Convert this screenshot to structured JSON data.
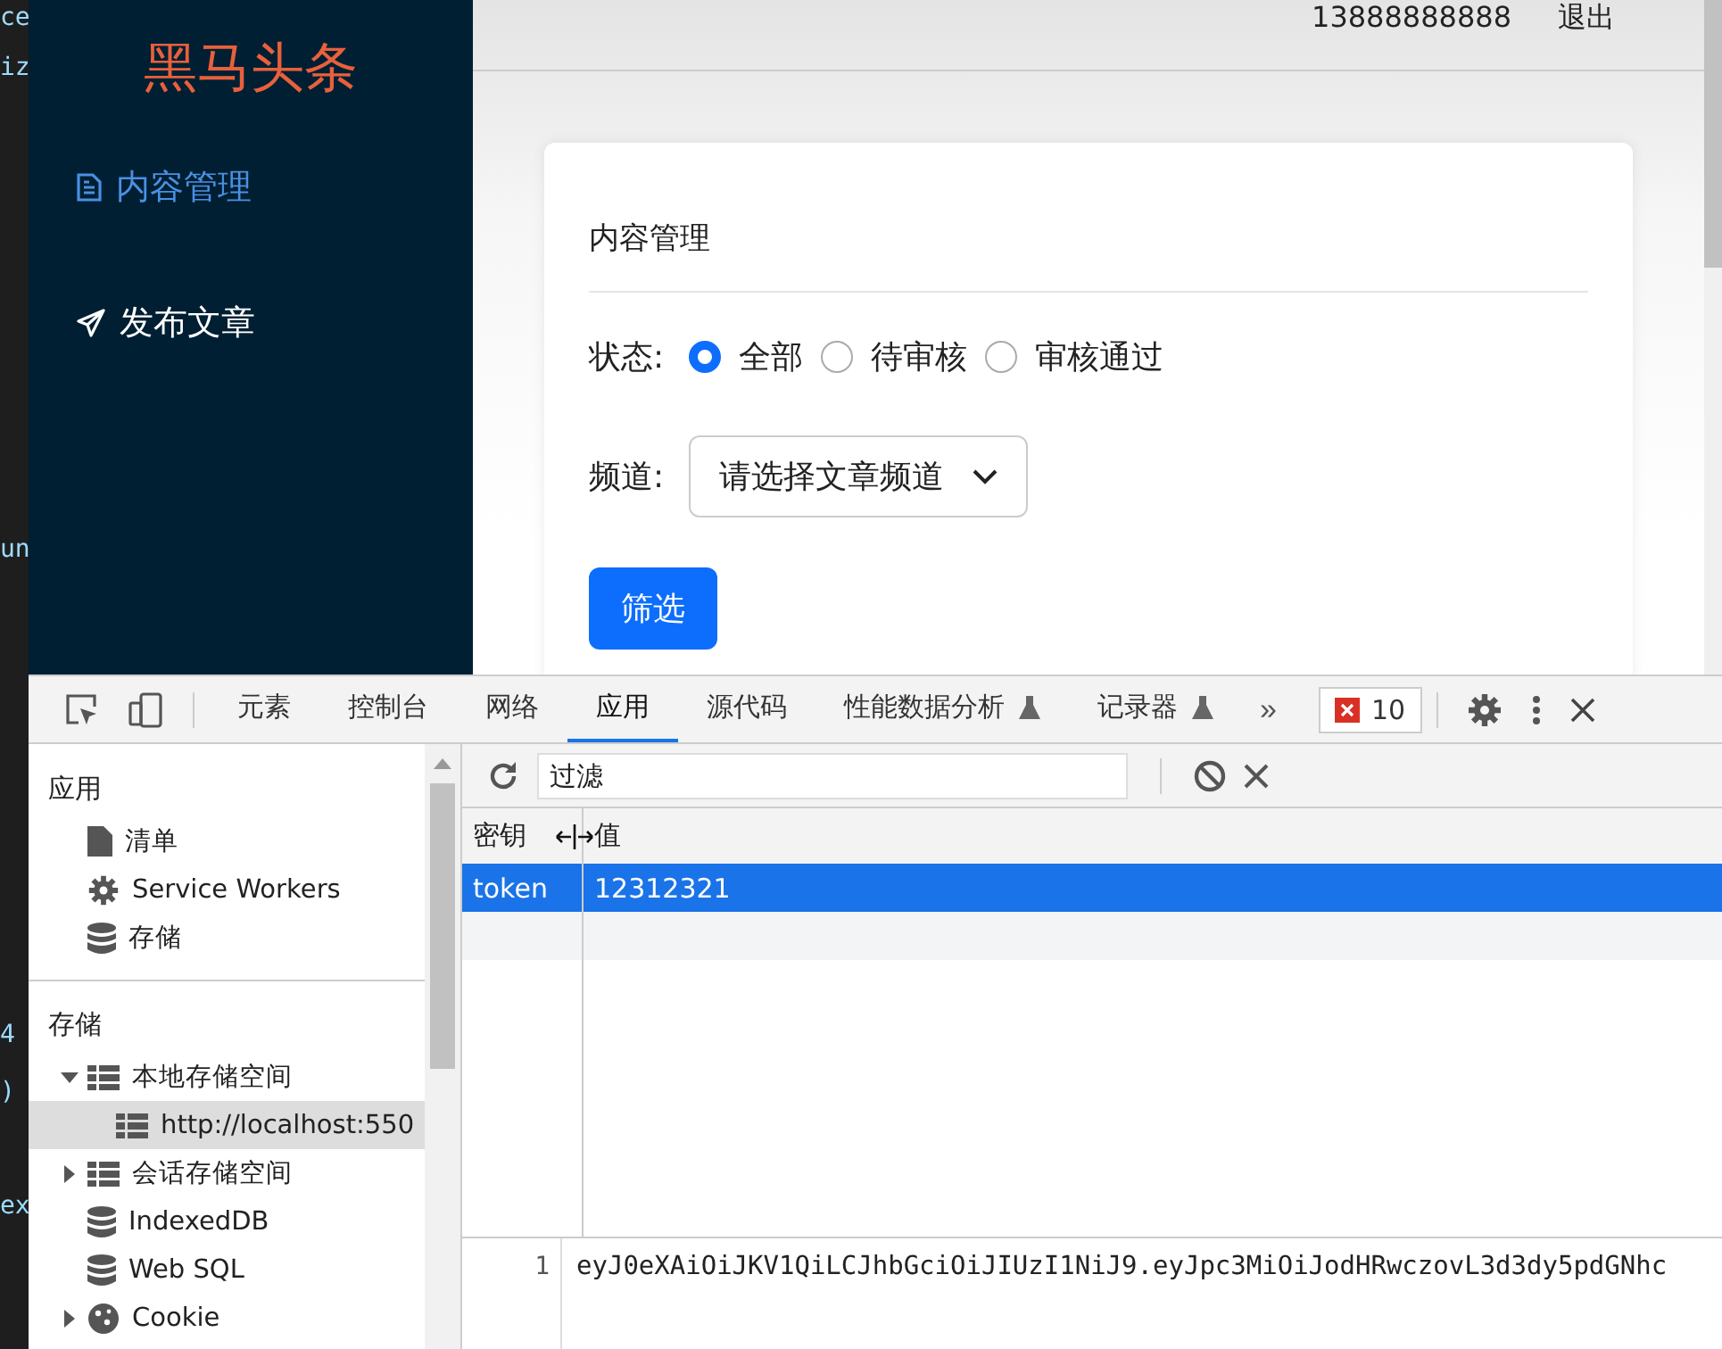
{
  "editor_fragments": [
    "ce",
    "iz",
    "un",
    "4",
    ")",
    "ex"
  ],
  "sidebar": {
    "logo": "黑马头条",
    "items": [
      {
        "label": "内容管理",
        "kind": "document",
        "selected": true
      },
      {
        "label": "发布文章",
        "kind": "send",
        "selected": false
      }
    ]
  },
  "header": {
    "phone": "13888888888",
    "logout": "退出"
  },
  "card": {
    "title": "内容管理",
    "status": {
      "label": "状态:",
      "options": [
        {
          "label": "全部",
          "selected": true
        },
        {
          "label": "待审核",
          "selected": false
        },
        {
          "label": "审核通过",
          "selected": false
        }
      ]
    },
    "channel": {
      "label": "频道:",
      "placeholder": "请选择文章频道"
    },
    "filter_button": "筛选"
  },
  "devtools": {
    "tabs": [
      {
        "label": "元素",
        "selected": false,
        "experimental": false
      },
      {
        "label": "控制台",
        "selected": false,
        "experimental": false
      },
      {
        "label": "网络",
        "selected": false,
        "experimental": false
      },
      {
        "label": "应用",
        "selected": true,
        "experimental": false
      },
      {
        "label": "源代码",
        "selected": false,
        "experimental": false
      },
      {
        "label": "性能数据分析",
        "selected": false,
        "experimental": true
      },
      {
        "label": "记录器",
        "selected": false,
        "experimental": true
      }
    ],
    "more": "»",
    "error_count": "10",
    "sidebar": {
      "sections": [
        {
          "title": "应用",
          "items": [
            {
              "label": "清单",
              "kind": "file",
              "selected": false
            },
            {
              "label": "Service Workers",
              "kind": "gear",
              "selected": false
            },
            {
              "label": "存储",
              "kind": "database",
              "selected": false
            }
          ]
        },
        {
          "title": "存储",
          "items": [
            {
              "label": "本地存储空间",
              "kind": "grid",
              "selected": false,
              "expanded": true,
              "children": [
                {
                  "label": "http://localhost:550",
                  "kind": "grid",
                  "selected": true
                }
              ]
            },
            {
              "label": "会话存储空间",
              "kind": "grid",
              "selected": false,
              "expanded": false
            },
            {
              "label": "IndexedDB",
              "kind": "database",
              "selected": false
            },
            {
              "label": "Web SQL",
              "kind": "database",
              "selected": false
            },
            {
              "label": "Cookie",
              "kind": "cookie",
              "selected": false,
              "expanded": false
            }
          ]
        }
      ]
    },
    "storage": {
      "filter_placeholder": "过滤",
      "columns": [
        "密钥",
        "值"
      ],
      "rows": [
        {
          "key": "token",
          "value": "12312321",
          "selected": true
        }
      ],
      "preview": {
        "line": "1",
        "text": "eyJ0eXAiOiJKV1QiLCJhbGciOiJIUzI1NiJ9.eyJpc3MiOiJodHRwczovL3d3dy5pdGNhc"
      }
    }
  }
}
